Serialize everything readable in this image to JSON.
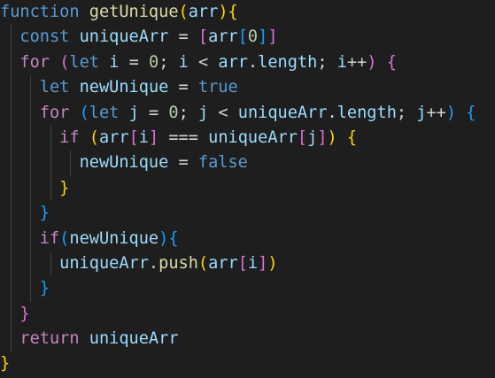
{
  "colors": {
    "background": "#1e1e1e",
    "keyword_blue": "#569cd6",
    "control_purple": "#c586c0",
    "function_yellow": "#dcdcaa",
    "variable_lightblue": "#9cdcfe",
    "number_green": "#b5cea8",
    "plain": "#d4d4d4",
    "bracket_gold": "#ffd700",
    "bracket_pink": "#da70d6",
    "bracket_blue": "#179fff",
    "indent_guide": "#404040"
  },
  "lines": [
    {
      "indent": 0,
      "tokens": [
        {
          "t": "function",
          "c": "#569cd6"
        },
        {
          "t": " ",
          "c": "#d4d4d4"
        },
        {
          "t": "getUnique",
          "c": "#dcdcaa"
        },
        {
          "t": "(",
          "c": "#ffd700"
        },
        {
          "t": "arr",
          "c": "#9cdcfe"
        },
        {
          "t": ")",
          "c": "#ffd700"
        },
        {
          "t": "{",
          "c": "#ffd700"
        }
      ]
    },
    {
      "indent": 1,
      "tokens": [
        {
          "t": "const",
          "c": "#569cd6"
        },
        {
          "t": " ",
          "c": "#d4d4d4"
        },
        {
          "t": "uniqueArr",
          "c": "#9cdcfe"
        },
        {
          "t": " = ",
          "c": "#d4d4d4"
        },
        {
          "t": "[",
          "c": "#da70d6"
        },
        {
          "t": "arr",
          "c": "#9cdcfe"
        },
        {
          "t": "[",
          "c": "#179fff"
        },
        {
          "t": "0",
          "c": "#b5cea8"
        },
        {
          "t": "]",
          "c": "#179fff"
        },
        {
          "t": "]",
          "c": "#da70d6"
        }
      ]
    },
    {
      "indent": 1,
      "tokens": [
        {
          "t": "for",
          "c": "#c586c0"
        },
        {
          "t": " ",
          "c": "#d4d4d4"
        },
        {
          "t": "(",
          "c": "#da70d6"
        },
        {
          "t": "let",
          "c": "#569cd6"
        },
        {
          "t": " ",
          "c": "#d4d4d4"
        },
        {
          "t": "i",
          "c": "#9cdcfe"
        },
        {
          "t": " = ",
          "c": "#d4d4d4"
        },
        {
          "t": "0",
          "c": "#b5cea8"
        },
        {
          "t": "; ",
          "c": "#d4d4d4"
        },
        {
          "t": "i",
          "c": "#9cdcfe"
        },
        {
          "t": " < ",
          "c": "#d4d4d4"
        },
        {
          "t": "arr",
          "c": "#9cdcfe"
        },
        {
          "t": ".",
          "c": "#d4d4d4"
        },
        {
          "t": "length",
          "c": "#9cdcfe"
        },
        {
          "t": "; ",
          "c": "#d4d4d4"
        },
        {
          "t": "i",
          "c": "#9cdcfe"
        },
        {
          "t": "++",
          "c": "#d4d4d4"
        },
        {
          "t": ")",
          "c": "#da70d6"
        },
        {
          "t": " ",
          "c": "#d4d4d4"
        },
        {
          "t": "{",
          "c": "#da70d6"
        }
      ]
    },
    {
      "indent": 2,
      "tokens": [
        {
          "t": "let",
          "c": "#569cd6"
        },
        {
          "t": " ",
          "c": "#d4d4d4"
        },
        {
          "t": "newUnique",
          "c": "#9cdcfe"
        },
        {
          "t": " = ",
          "c": "#d4d4d4"
        },
        {
          "t": "true",
          "c": "#569cd6"
        }
      ]
    },
    {
      "indent": 2,
      "tokens": [
        {
          "t": "for",
          "c": "#c586c0"
        },
        {
          "t": " ",
          "c": "#d4d4d4"
        },
        {
          "t": "(",
          "c": "#179fff"
        },
        {
          "t": "let",
          "c": "#569cd6"
        },
        {
          "t": " ",
          "c": "#d4d4d4"
        },
        {
          "t": "j",
          "c": "#9cdcfe"
        },
        {
          "t": " = ",
          "c": "#d4d4d4"
        },
        {
          "t": "0",
          "c": "#b5cea8"
        },
        {
          "t": "; ",
          "c": "#d4d4d4"
        },
        {
          "t": "j",
          "c": "#9cdcfe"
        },
        {
          "t": " < ",
          "c": "#d4d4d4"
        },
        {
          "t": "uniqueArr",
          "c": "#9cdcfe"
        },
        {
          "t": ".",
          "c": "#d4d4d4"
        },
        {
          "t": "length",
          "c": "#9cdcfe"
        },
        {
          "t": "; ",
          "c": "#d4d4d4"
        },
        {
          "t": "j",
          "c": "#9cdcfe"
        },
        {
          "t": "++",
          "c": "#d4d4d4"
        },
        {
          "t": ")",
          "c": "#179fff"
        },
        {
          "t": " ",
          "c": "#d4d4d4"
        },
        {
          "t": "{",
          "c": "#179fff"
        }
      ]
    },
    {
      "indent": 3,
      "tokens": [
        {
          "t": "if",
          "c": "#c586c0"
        },
        {
          "t": " ",
          "c": "#d4d4d4"
        },
        {
          "t": "(",
          "c": "#ffd700"
        },
        {
          "t": "arr",
          "c": "#9cdcfe"
        },
        {
          "t": "[",
          "c": "#da70d6"
        },
        {
          "t": "i",
          "c": "#9cdcfe"
        },
        {
          "t": "]",
          "c": "#da70d6"
        },
        {
          "t": " === ",
          "c": "#d4d4d4"
        },
        {
          "t": "uniqueArr",
          "c": "#9cdcfe"
        },
        {
          "t": "[",
          "c": "#da70d6"
        },
        {
          "t": "j",
          "c": "#9cdcfe"
        },
        {
          "t": "]",
          "c": "#da70d6"
        },
        {
          "t": ")",
          "c": "#ffd700"
        },
        {
          "t": " ",
          "c": "#d4d4d4"
        },
        {
          "t": "{",
          "c": "#ffd700"
        }
      ]
    },
    {
      "indent": 4,
      "tokens": [
        {
          "t": "newUnique",
          "c": "#9cdcfe"
        },
        {
          "t": " = ",
          "c": "#d4d4d4"
        },
        {
          "t": "false",
          "c": "#569cd6"
        }
      ]
    },
    {
      "indent": 3,
      "tokens": [
        {
          "t": "}",
          "c": "#ffd700"
        }
      ]
    },
    {
      "indent": 2,
      "tokens": [
        {
          "t": "}",
          "c": "#179fff"
        }
      ]
    },
    {
      "indent": 2,
      "tokens": [
        {
          "t": "if",
          "c": "#c586c0"
        },
        {
          "t": "(",
          "c": "#179fff"
        },
        {
          "t": "newUnique",
          "c": "#9cdcfe"
        },
        {
          "t": ")",
          "c": "#179fff"
        },
        {
          "t": "{",
          "c": "#179fff"
        }
      ]
    },
    {
      "indent": 3,
      "tokens": [
        {
          "t": "uniqueArr",
          "c": "#9cdcfe"
        },
        {
          "t": ".",
          "c": "#d4d4d4"
        },
        {
          "t": "push",
          "c": "#dcdcaa"
        },
        {
          "t": "(",
          "c": "#ffd700"
        },
        {
          "t": "arr",
          "c": "#9cdcfe"
        },
        {
          "t": "[",
          "c": "#da70d6"
        },
        {
          "t": "i",
          "c": "#9cdcfe"
        },
        {
          "t": "]",
          "c": "#da70d6"
        },
        {
          "t": ")",
          "c": "#ffd700"
        }
      ]
    },
    {
      "indent": 2,
      "tokens": [
        {
          "t": "}",
          "c": "#179fff"
        }
      ]
    },
    {
      "indent": 1,
      "tokens": [
        {
          "t": "}",
          "c": "#da70d6"
        }
      ]
    },
    {
      "indent": 1,
      "tokens": [
        {
          "t": "return",
          "c": "#c586c0"
        },
        {
          "t": " ",
          "c": "#d4d4d4"
        },
        {
          "t": "uniqueArr",
          "c": "#9cdcfe"
        }
      ]
    },
    {
      "indent": 0,
      "tokens": [
        {
          "t": "}",
          "c": "#ffd700"
        }
      ]
    }
  ]
}
